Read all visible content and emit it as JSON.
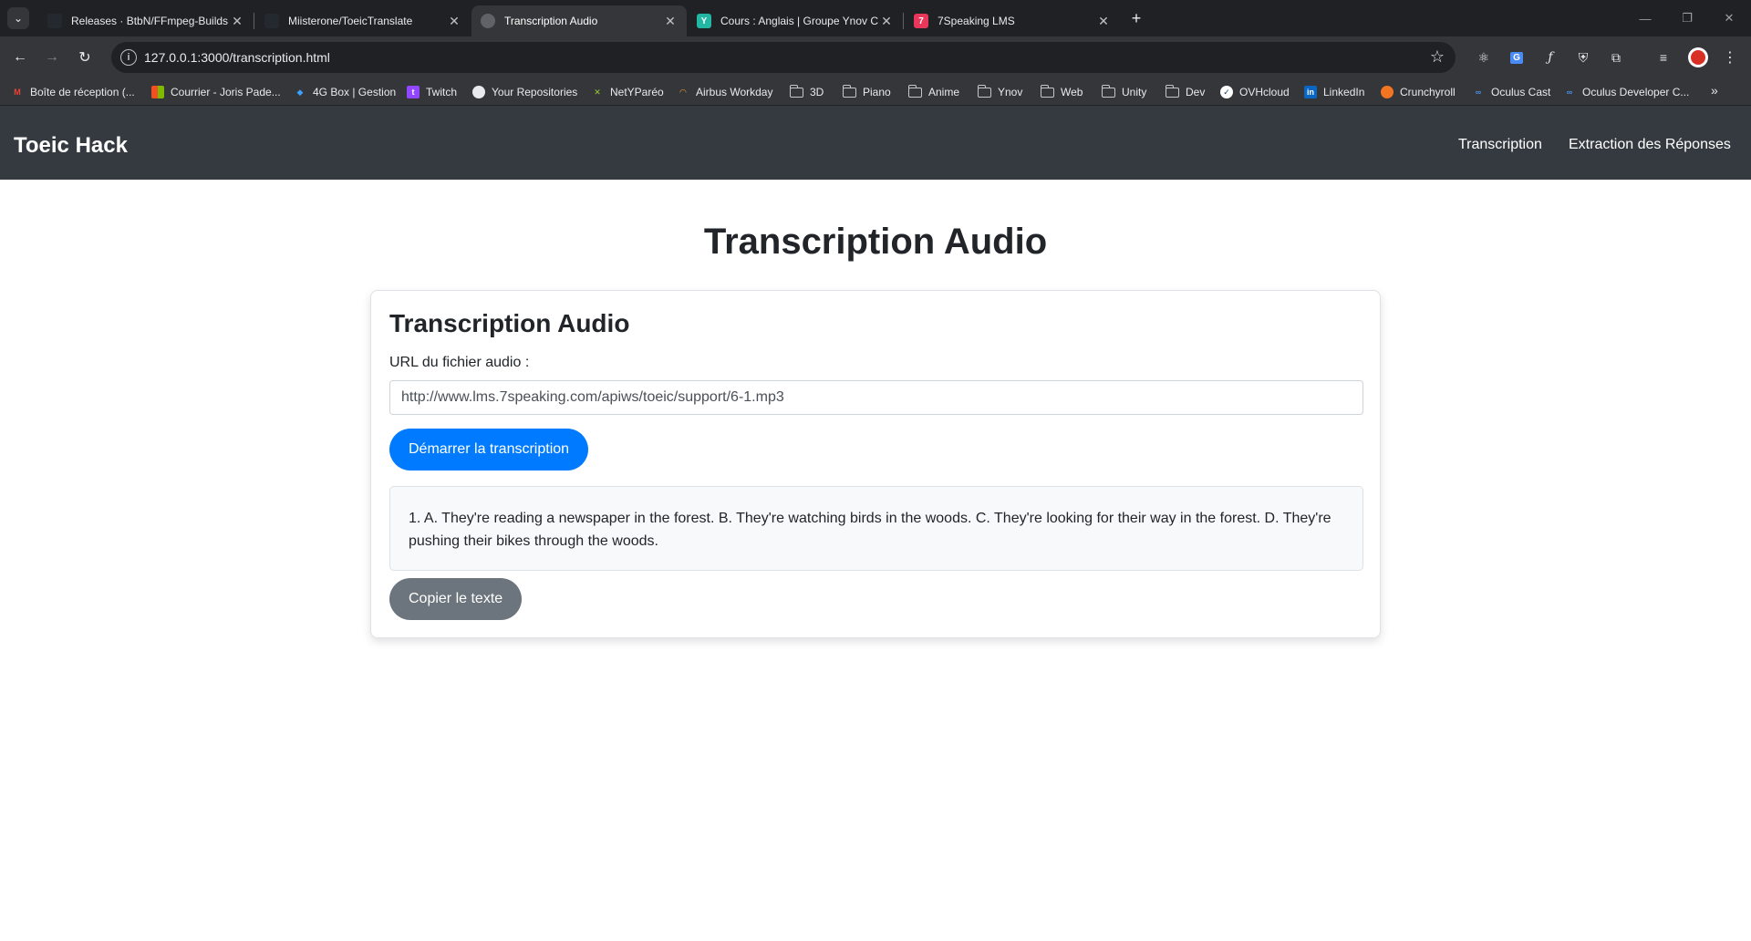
{
  "browser": {
    "tabs": [
      {
        "title": "Releases · BtbN/FFmpeg-Builds",
        "active": false
      },
      {
        "title": "Miisterone/ToeicTranslate",
        "active": false
      },
      {
        "title": "Transcription Audio",
        "active": true
      },
      {
        "title": "Cours : Anglais | Groupe Ynov C",
        "active": false
      },
      {
        "title": "7Speaking LMS",
        "active": false
      }
    ],
    "url": "127.0.0.1:3000/transcription.html",
    "bookmarks": [
      "Boîte de réception (...",
      "Courrier - Joris Pade...",
      "4G Box | Gestion",
      "Twitch",
      "Your Repositories",
      "NetYParéo",
      "Airbus Workday",
      "3D",
      "Piano",
      "Anime",
      "Ynov",
      "Web",
      "Unity",
      "Dev",
      "OVHcloud",
      "LinkedIn",
      "Crunchyroll",
      "Oculus Cast",
      "Oculus Developer C..."
    ],
    "colors": {
      "tabstrip": "#202124",
      "toolbar": "#35363a"
    }
  },
  "navbar": {
    "brand": "Toeic Hack",
    "links": [
      "Transcription",
      "Extraction des Réponses"
    ],
    "background": "#343a40"
  },
  "main": {
    "page_title": "Transcription Audio",
    "card": {
      "title": "Transcription Audio",
      "url_label": "URL du fichier audio :",
      "url_value": "http://www.lms.7speaking.com/apiws/toeic/support/6-1.mp3",
      "start_button": "Démarrer la transcription",
      "transcription": "1. A. They're reading a newspaper in the forest. B. They're watching birds in the woods. C. They're looking for their way in the forest. D. They're pushing their bikes through the woods.",
      "copy_button": "Copier le texte"
    },
    "colors": {
      "primary": "#007bff",
      "secondary": "#6c757d"
    }
  }
}
